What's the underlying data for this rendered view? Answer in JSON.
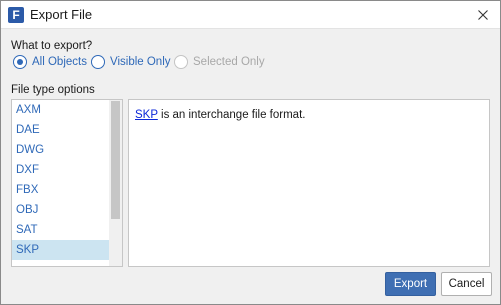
{
  "window": {
    "title": "Export File",
    "app_icon_letter": "F"
  },
  "export_scope": {
    "label": "What to export?",
    "options": [
      {
        "label": "All Objects",
        "selected": true,
        "enabled": true
      },
      {
        "label": "Visible Only",
        "selected": false,
        "enabled": true
      },
      {
        "label": "Selected Only",
        "selected": false,
        "enabled": false
      }
    ]
  },
  "file_types": {
    "label": "File type options",
    "items": [
      "AXM",
      "DAE",
      "DWG",
      "DXF",
      "FBX",
      "OBJ",
      "SAT",
      "SKP"
    ],
    "selected": "SKP"
  },
  "description": {
    "link_text": "SKP",
    "rest": " is an interchange file format."
  },
  "buttons": {
    "export": "Export",
    "cancel": "Cancel"
  },
  "colors": {
    "accent": "#2f69b8",
    "primary_button": "#3f6fb3",
    "selection": "#cce4f1",
    "link": "#0b27d9"
  }
}
